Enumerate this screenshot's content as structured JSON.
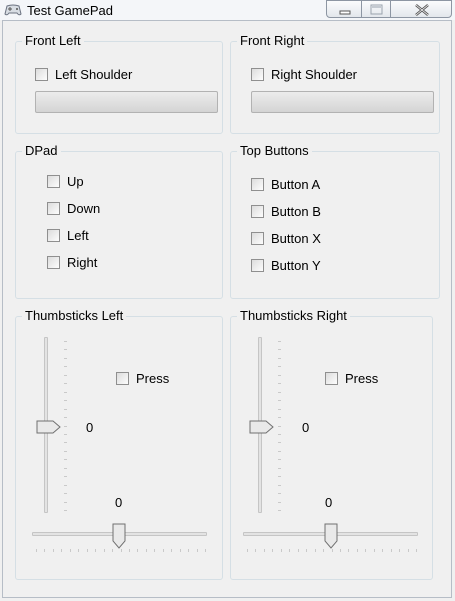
{
  "window": {
    "title": "Test GamePad",
    "icon": "gamepad-icon"
  },
  "front_left": {
    "label": "Front Left",
    "checkbox": "Left Shoulder",
    "checked": false,
    "trigger_value": 0
  },
  "front_right": {
    "label": "Front Right",
    "checkbox": "Right Shoulder",
    "checked": false,
    "trigger_value": 0
  },
  "dpad": {
    "label": "DPad",
    "items": [
      "Up",
      "Down",
      "Left",
      "Right"
    ]
  },
  "top_buttons": {
    "label": "Top Buttons",
    "items": [
      "Button A",
      "Button B",
      "Button X",
      "Button Y"
    ]
  },
  "thumb_left": {
    "label": "Thumbsticks Left",
    "press": "Press",
    "vertical_value": "0",
    "horizontal_value": "0"
  },
  "thumb_right": {
    "label": "Thumbsticks Right",
    "press": "Press",
    "vertical_value": "0",
    "horizontal_value": "0"
  }
}
